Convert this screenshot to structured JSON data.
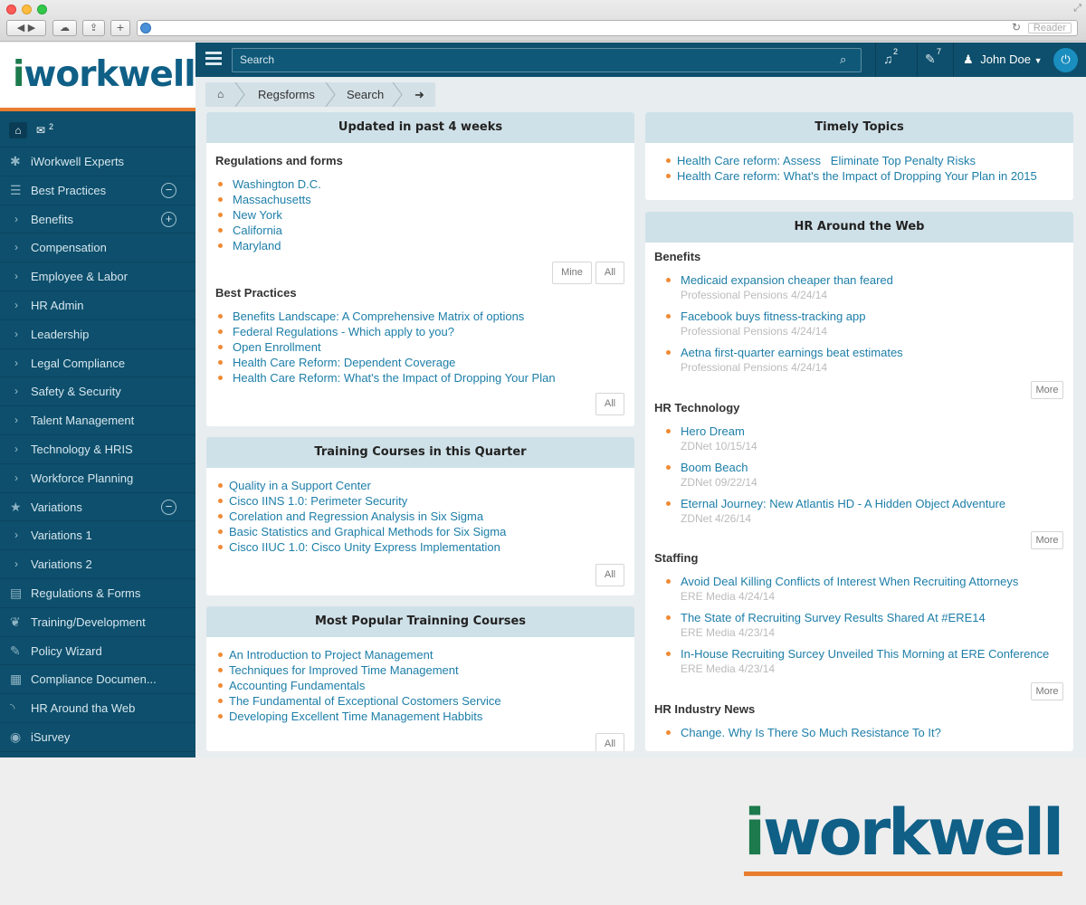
{
  "browser": {
    "reader_label": "Reader"
  },
  "brand": {
    "logo_i": "i",
    "logo_rest": "workwell",
    "accent": "#e87d2f",
    "dark_blue": "#0d4f6c"
  },
  "header": {
    "search_placeholder": "Search",
    "notifications_count": "2",
    "messages_count": "7",
    "user_name": "John Doe"
  },
  "sidebar": {
    "mail_badge": "2",
    "items": [
      {
        "label": "iWorkwell Experts",
        "icon": "asterisk-icon",
        "kind": "icon"
      },
      {
        "label": "Best Practices",
        "icon": "list-icon",
        "kind": "icon",
        "toggle": "minus"
      },
      {
        "label": "Benefits",
        "kind": "chev",
        "toggle": "plus"
      },
      {
        "label": "Compensation",
        "kind": "chev"
      },
      {
        "label": "Employee & Labor",
        "kind": "chev"
      },
      {
        "label": "HR Admin",
        "kind": "chev"
      },
      {
        "label": "Leadership",
        "kind": "chev"
      },
      {
        "label": "Legal Compliance",
        "kind": "chev"
      },
      {
        "label": "Safety & Security",
        "kind": "chev"
      },
      {
        "label": "Talent Management",
        "kind": "chev"
      },
      {
        "label": "Technology & HRIS",
        "kind": "chev"
      },
      {
        "label": "Workforce Planning",
        "kind": "chev"
      },
      {
        "label": "Variations",
        "icon": "star-icon",
        "kind": "icon",
        "toggle": "minus"
      },
      {
        "label": "Variations 1",
        "kind": "chev"
      },
      {
        "label": "Variations 2",
        "kind": "chev"
      },
      {
        "label": "Regulations & Forms",
        "icon": "bar-chart-icon",
        "kind": "icon"
      },
      {
        "label": "Training/Development",
        "icon": "leaf-icon",
        "kind": "icon"
      },
      {
        "label": "Policy Wizard",
        "icon": "edit-icon",
        "kind": "icon"
      },
      {
        "label": "Compliance Documen...",
        "icon": "document-icon",
        "kind": "icon"
      },
      {
        "label": "HR Around tha Web",
        "icon": "rss-icon",
        "kind": "icon"
      },
      {
        "label": "iSurvey",
        "icon": "eye-icon",
        "kind": "icon"
      }
    ]
  },
  "breadcrumb": {
    "items": [
      "Regsforms",
      "Search"
    ]
  },
  "updated": {
    "title": "Updated in past 4 weeks",
    "regs_heading": "Regulations and forms",
    "regs": [
      "Washington D.C.",
      "Massachusetts",
      "New York",
      "California",
      "Maryland"
    ],
    "mine_label": "Mine",
    "all_label": "All",
    "bp_heading": "Best Practices",
    "bp": [
      "Benefits Landscape: A Comprehensive Matrix of options",
      "Federal Regulations - Which apply to you?",
      "Open Enrollment",
      "Health Care Reform: Dependent Coverage",
      "Health Care Reform: What's the Impact of Dropping Your Plan"
    ]
  },
  "training": {
    "title": "Training Courses in this Quarter",
    "items": [
      "Quality in a Support Center",
      "Cisco IINS 1.0: Perimeter Security",
      "Corelation and Regression Analysis in Six Sigma",
      "Basic Statistics and Graphical Methods for Six Sigma",
      "Cisco IIUC 1.0: Cisco Unity Express Implementation"
    ],
    "all_label": "All"
  },
  "popular": {
    "title": "Most Popular Trainning Courses",
    "items": [
      "An Introduction to Project Management",
      "Techniques for Improved Time Management",
      "Accounting Fundamentals",
      "The Fundamental of Exceptional Costomers Service",
      "Developing Excellent Time Management Habbits"
    ],
    "all_label": "All"
  },
  "topics": {
    "title": "Timely Topics",
    "items": [
      "Health Care reform: Assess   Eliminate Top Penalty Risks",
      "Health Care reform: What's the Impact of Dropping Your Plan in 2015"
    ]
  },
  "web": {
    "title": "HR Around the Web",
    "more_label": "More",
    "sections": [
      {
        "heading": "Benefits",
        "items": [
          {
            "title": "Medicaid expansion cheaper than feared",
            "source": "Professional Pensions 4/24/14"
          },
          {
            "title": "Facebook buys fitness-tracking app",
            "source": "Professional Pensions 4/24/14"
          },
          {
            "title": "Aetna first-quarter earnings beat estimates",
            "source": "Professional Pensions 4/24/14"
          }
        ]
      },
      {
        "heading": "HR Technology",
        "items": [
          {
            "title": "Hero Dream",
            "source": "ZDNet 10/15/14"
          },
          {
            "title": "Boom Beach",
            "source": "ZDNet 09/22/14"
          },
          {
            "title": "Eternal Journey: New Atlantis HD - A Hidden Object Adventure",
            "source": "ZDNet 4/26/14"
          }
        ]
      },
      {
        "heading": "Staffing",
        "items": [
          {
            "title": "Avoid Deal Killing Conflicts of Interest When Recruiting Attorneys",
            "source": "ERE Media 4/24/14"
          },
          {
            "title": "The State of Recruiting Survey Results Shared At #ERE14",
            "source": "ERE Media 4/23/14"
          },
          {
            "title": "In-House Recruiting Surcey Unveiled This Morning at ERE Conference",
            "source": "ERE Media 4/23/14"
          }
        ]
      },
      {
        "heading": "HR Industry News",
        "items": [
          {
            "title": "Change. Why Is There So Much Resistance To It?",
            "source": ""
          }
        ]
      }
    ]
  }
}
